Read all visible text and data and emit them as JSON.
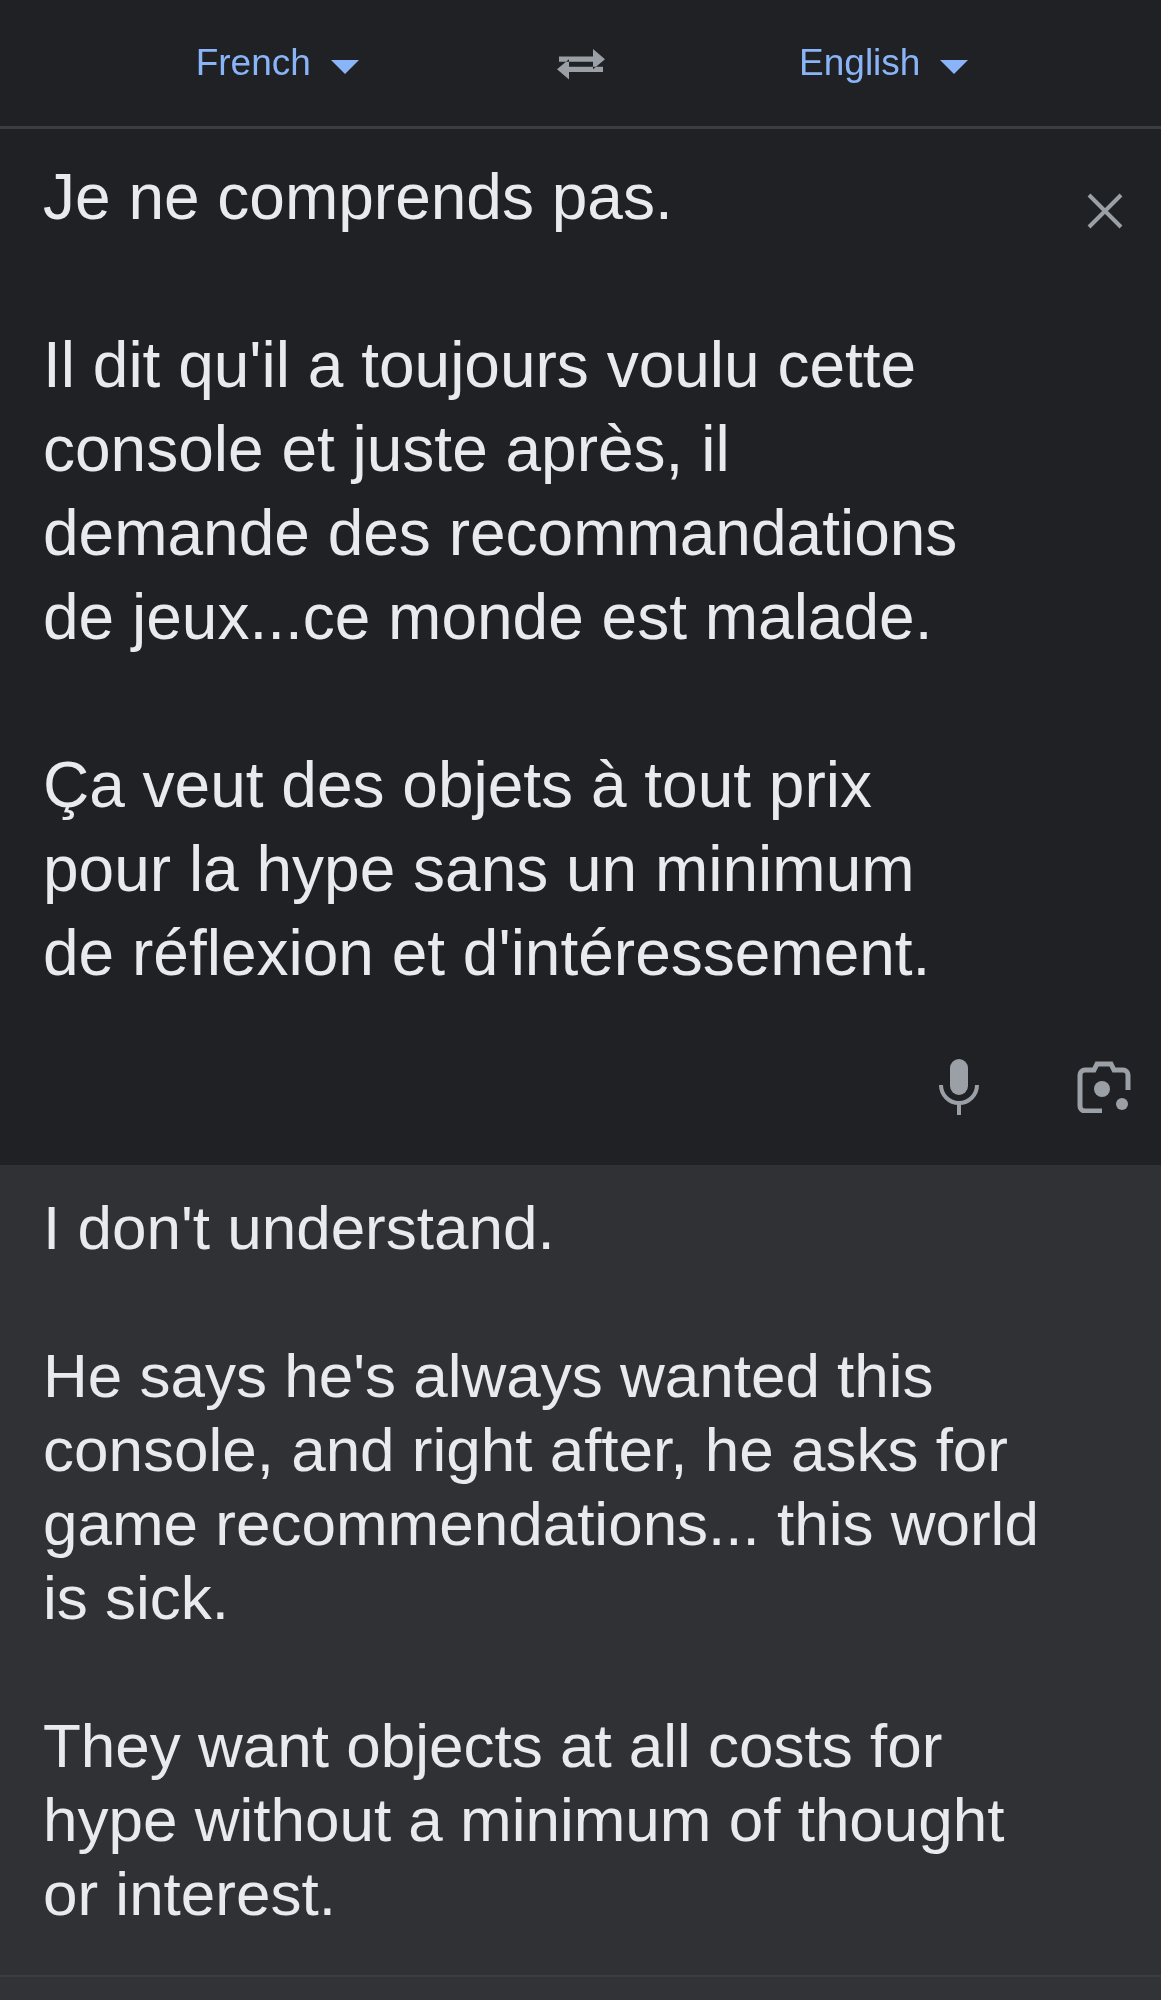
{
  "language_bar": {
    "source_language": "French",
    "target_language": "English"
  },
  "source": {
    "text": "Je ne comprends pas.\n\nIl dit qu'il a toujours voulu cette\nconsole et juste après, il\ndemande des recommandations\nde jeux...ce monde est malade.\n\nÇa veut des objets à tout prix\npour la hype sans un minimum\nde réflexion et d'intéressement."
  },
  "translation": {
    "text": "I don't understand.\n\nHe says he's always wanted this\nconsole, and right after, he asks for\ngame recommendations... this world\nis sick.\n\nThey want objects at all costs for\nhype without a minimum of thought\nor interest."
  }
}
